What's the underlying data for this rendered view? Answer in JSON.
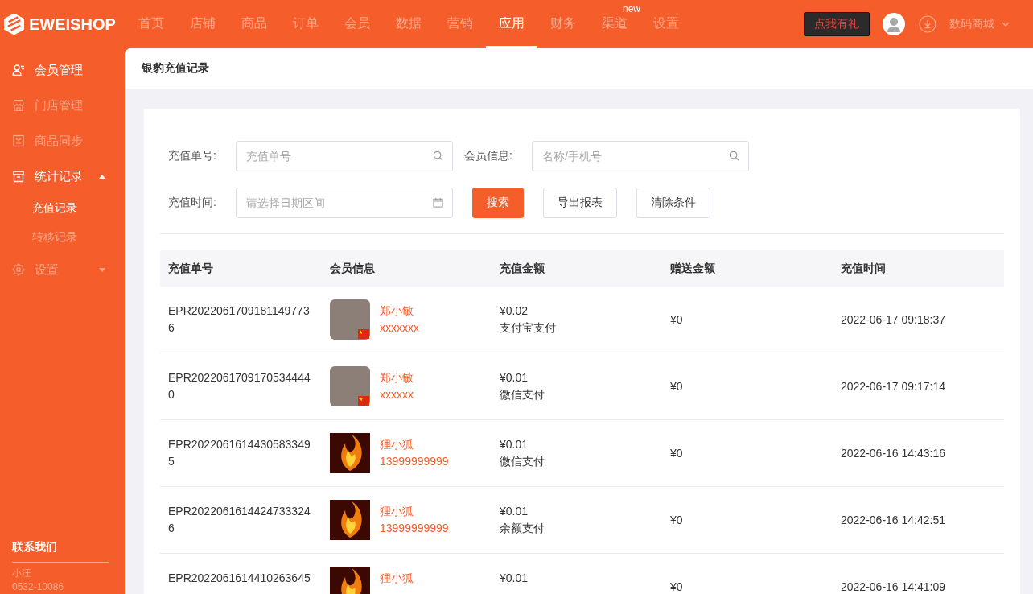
{
  "top_bar": {
    "logo": "EWEISHOP",
    "nav": [
      {
        "label": "首页",
        "selected": false
      },
      {
        "label": "店铺",
        "selected": false
      },
      {
        "label": "商品",
        "selected": false
      },
      {
        "label": "订单",
        "selected": false
      },
      {
        "label": "会员",
        "selected": false
      },
      {
        "label": "数据",
        "selected": false
      },
      {
        "label": "营销",
        "selected": false
      },
      {
        "label": "应用",
        "selected": true
      },
      {
        "label": "财务",
        "selected": false
      },
      {
        "label": "渠道",
        "selected": false,
        "badge": "new"
      },
      {
        "label": "设置",
        "selected": false
      }
    ],
    "promo_button": "点我有礼",
    "store_menu": "数码商城"
  },
  "sidebar": {
    "items": [
      {
        "label": "会员管理",
        "selected": true
      },
      {
        "label": "门店管理",
        "selected": false
      },
      {
        "label": "商品同步",
        "selected": false
      },
      {
        "label": "统计记录",
        "selected": true,
        "expanded": true,
        "children": [
          {
            "label": "充值记录",
            "selected": true
          },
          {
            "label": "转移记录",
            "selected": false
          }
        ]
      },
      {
        "label": "设置",
        "selected": false,
        "expanded": false
      }
    ],
    "contact": {
      "title": "联系我们",
      "name": "小汪",
      "phone": "0532-10086"
    }
  },
  "page_header": {
    "title": "银豹充值记录"
  },
  "filters": {
    "fields": [
      {
        "label": "充值单号:",
        "placeholder": "充值单号",
        "kind": "search"
      },
      {
        "label": "会员信息:",
        "placeholder": "名称/手机号",
        "kind": "search"
      },
      {
        "label": "充值时间:",
        "placeholder": "请选择日期区间",
        "kind": "date"
      }
    ],
    "buttons": [
      {
        "label": "搜索",
        "kind": "primary"
      },
      {
        "label": "导出报表",
        "kind": "default"
      },
      {
        "label": "清除条件",
        "kind": "default"
      }
    ]
  },
  "table": {
    "columns": [
      "充值单号",
      "会员信息",
      "充值金额",
      "赠送金额",
      "充值时间"
    ],
    "rows": [
      {
        "order_no": "EPR20220617091811497736",
        "avatar": {
          "kind": "portrait"
        },
        "member_name": "郑小敏",
        "member_contact": "xxxxxxx",
        "amount": "¥0.02",
        "payment": "支付宝支付",
        "gift": "¥0",
        "time": "2022-06-17 09:18:37"
      },
      {
        "order_no": "EPR20220617091705344440",
        "avatar": {
          "kind": "portrait"
        },
        "member_name": "郑小敏",
        "member_contact": "xxxxxx",
        "amount": "¥0.01",
        "payment": "微信支付",
        "gift": "¥0",
        "time": "2022-06-17 09:17:14"
      },
      {
        "order_no": "EPR20220616144305833495",
        "avatar": {
          "kind": "flame"
        },
        "member_name": "狸小狐",
        "member_contact": "13999999999",
        "amount": "¥0.01",
        "payment": "微信支付",
        "gift": "¥0",
        "time": "2022-06-16 14:43:16"
      },
      {
        "order_no": "EPR20220616144247333246",
        "avatar": {
          "kind": "flame"
        },
        "member_name": "狸小狐",
        "member_contact": "13999999999",
        "amount": "¥0.01",
        "payment": "余额支付",
        "gift": "¥0",
        "time": "2022-06-16 14:42:51"
      },
      {
        "order_no": "EPR2022061614410263645",
        "avatar": {
          "kind": "flame"
        },
        "member_name": "狸小狐",
        "amount": "¥0.01",
        "gift": "¥0",
        "time": "2022-06-16 14:41:09"
      }
    ]
  }
}
